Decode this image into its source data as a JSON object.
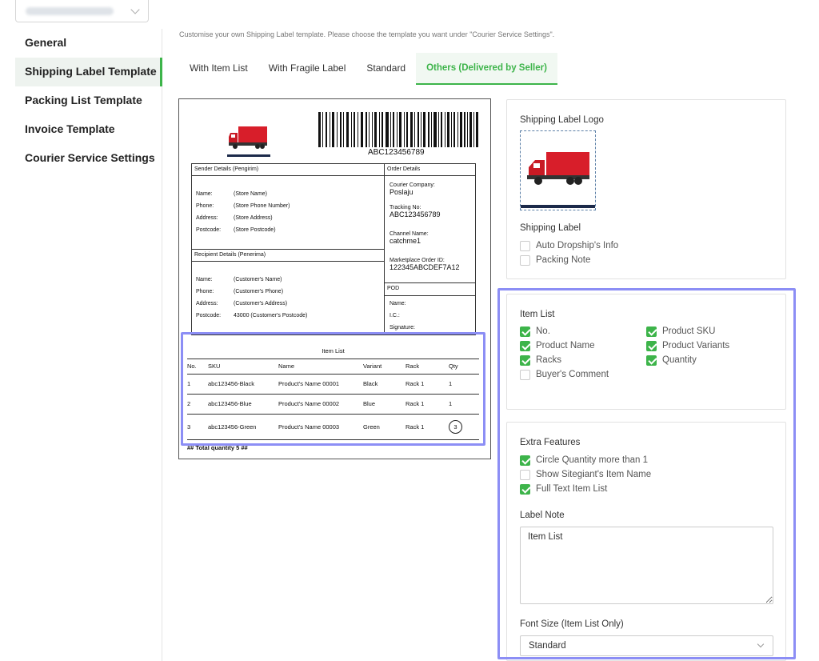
{
  "sidebar": {
    "items": [
      {
        "label": "General"
      },
      {
        "label": "Shipping Label Template"
      },
      {
        "label": "Packing List Template"
      },
      {
        "label": "Invoice Template"
      },
      {
        "label": "Courier Service Settings"
      }
    ],
    "active_index": 1
  },
  "hint": "Customise your own Shipping Label template. Please choose the template you want under \"Courier Service Settings\".",
  "tabs": [
    {
      "label": "With Item List"
    },
    {
      "label": "With Fragile Label"
    },
    {
      "label": "Standard"
    },
    {
      "label": "Others (Delivered by Seller)"
    }
  ],
  "active_tab": 3,
  "preview": {
    "barcode_number": "ABC123456789",
    "sender_header": "Sender Details (Pengirim)",
    "sender": [
      {
        "key": "Name:",
        "value": "(Store Name)"
      },
      {
        "key": "Phone:",
        "value": "(Store Phone Number)"
      },
      {
        "key": "Address:",
        "value": "(Store Address)"
      },
      {
        "key": "Postcode:",
        "value": "(Store Postcode)"
      }
    ],
    "recipient_header": "Recipient Details (Penerima)",
    "recipient": [
      {
        "key": "Name:",
        "value": "(Customer's Name)"
      },
      {
        "key": "Phone:",
        "value": "(Customer's Phone)"
      },
      {
        "key": "Address:",
        "value": "(Customer's Address)"
      },
      {
        "key": "Postcode:",
        "value": "43000 (Customer's Postcode)"
      }
    ],
    "order_header": "Order Details",
    "order": [
      {
        "label": "Courier Company:",
        "value": "Poslaju"
      },
      {
        "label": "Tracking No:",
        "value": "ABC123456789"
      },
      {
        "label": "Channel Name:",
        "value": "catchme1"
      },
      {
        "label": "Marketplace Order ID:",
        "value": "122345ABCDEF7A12"
      }
    ],
    "pod_header": "POD",
    "pod_fields": [
      "Name:",
      "I.C.:",
      "Signature:"
    ],
    "item_list_title": "Item List",
    "item_columns": [
      "No.",
      "SKU",
      "Name",
      "Variant",
      "Rack",
      "Qty"
    ],
    "items": [
      {
        "no": "1",
        "sku": "abc123456-Black",
        "name": "Product's Name 00001",
        "variant": "Black",
        "rack": "Rack 1",
        "qty": "1",
        "circled": false
      },
      {
        "no": "2",
        "sku": "abc123456-Blue",
        "name": "Product's Name 00002",
        "variant": "Blue",
        "rack": "Rack 1",
        "qty": "1",
        "circled": false
      },
      {
        "no": "3",
        "sku": "abc123456-Green",
        "name": "Product's Name 00003",
        "variant": "Green",
        "rack": "Rack 1",
        "qty": "3",
        "circled": true
      }
    ],
    "total_line": "## Total quantity 5 ##"
  },
  "logo_panel": {
    "title": "Shipping Label Logo",
    "shipping_label_title": "Shipping Label",
    "options": [
      {
        "label": "Auto Dropship's Info",
        "checked": false
      },
      {
        "label": "Packing Note",
        "checked": false
      }
    ]
  },
  "item_list_panel": {
    "title": "Item List",
    "left_options": [
      {
        "label": "No.",
        "checked": true
      },
      {
        "label": "Product Name",
        "checked": true
      },
      {
        "label": "Racks",
        "checked": true
      },
      {
        "label": "Buyer's Comment",
        "checked": false
      }
    ],
    "right_options": [
      {
        "label": "Product SKU",
        "checked": true
      },
      {
        "label": "Product Variants",
        "checked": true
      },
      {
        "label": "Quantity",
        "checked": true
      }
    ]
  },
  "extra_panel": {
    "title": "Extra Features",
    "options": [
      {
        "label": "Circle Quantity more than 1",
        "checked": true
      },
      {
        "label": "Show Sitegiant's Item Name",
        "checked": false
      },
      {
        "label": "Full Text Item List",
        "checked": true
      }
    ],
    "label_note_title": "Label Note",
    "label_note_value": "Item List",
    "font_size_title": "Font Size (Item List Only)",
    "font_size_value": "Standard"
  },
  "colors": {
    "accent": "#3db44a",
    "highlight": "#8c8ef5",
    "truck_red": "#d81e2a"
  }
}
